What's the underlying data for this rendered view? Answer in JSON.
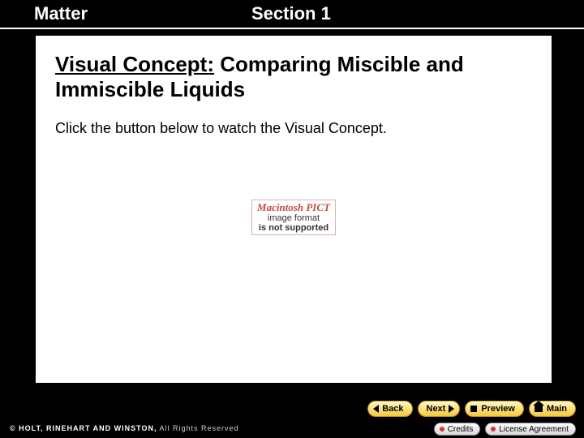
{
  "header": {
    "left": "Matter",
    "right": "Section 1"
  },
  "slide": {
    "title_prefix": "Visual Concept:",
    "title_rest": " Comparing Miscible and Immiscible Liquids",
    "instruction": "Click the button below to watch the Visual Concept."
  },
  "placeholder": {
    "line1": "Macintosh PICT",
    "line2": "image format",
    "line3": "is not supported"
  },
  "nav": {
    "back": "Back",
    "next": "Next",
    "preview": "Preview",
    "main": "Main"
  },
  "footer": {
    "copyright_brand": "© HOLT, RINEHART AND WINSTON,",
    "copyright_rest": " All Rights Reserved",
    "credits": "Credits",
    "license": "License Agreement"
  }
}
